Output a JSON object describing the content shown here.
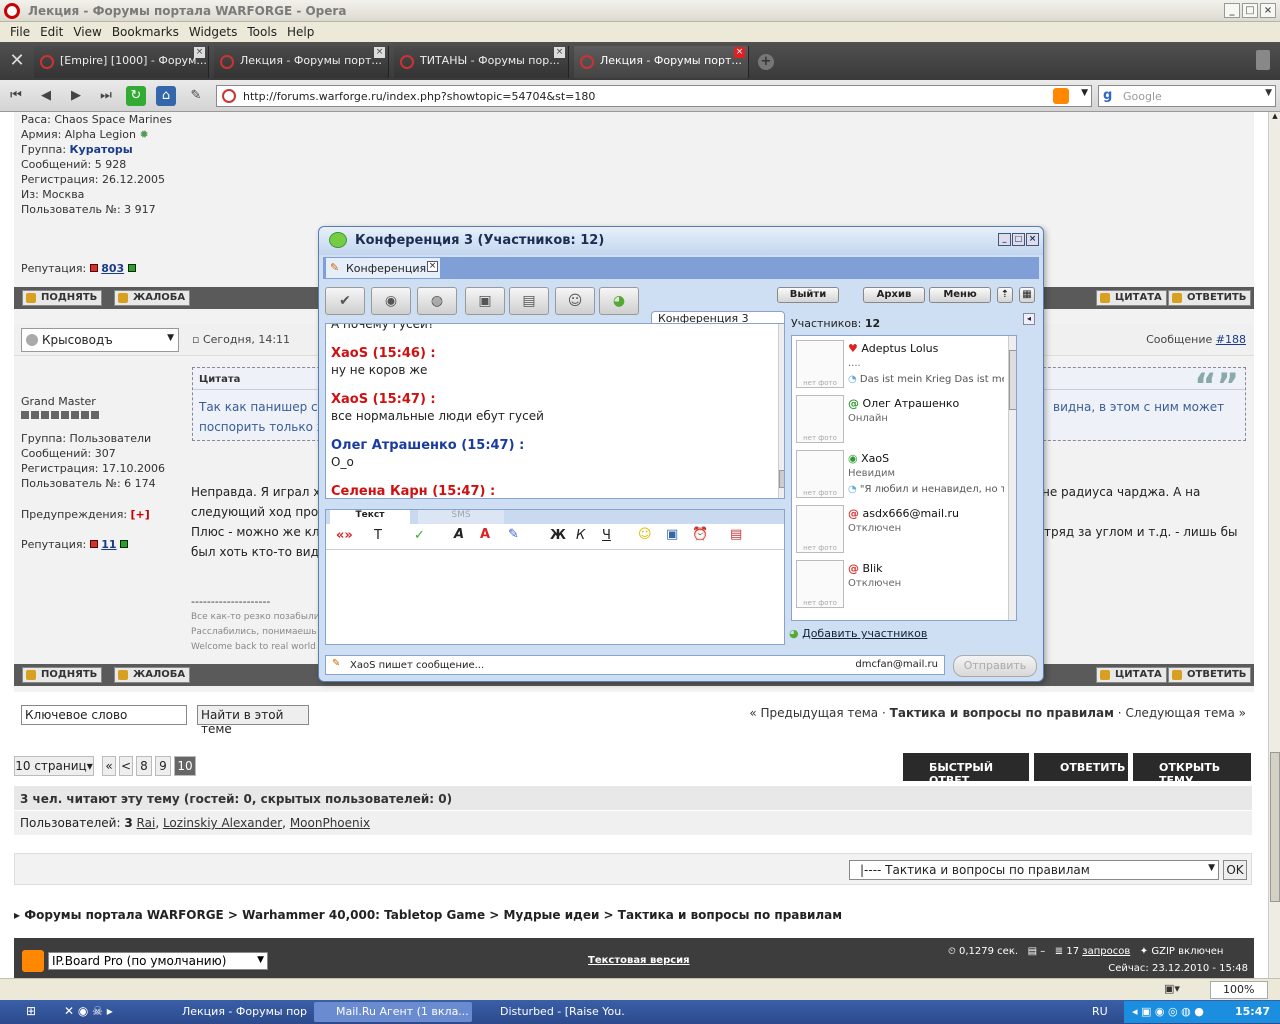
{
  "window": {
    "title": "Лекция - Форумы портала WARFORGE - Opera"
  },
  "menu": [
    "File",
    "Edit",
    "View",
    "Bookmarks",
    "Widgets",
    "Tools",
    "Help"
  ],
  "tabs": [
    {
      "label": "[Empire] [1000] - Форум..."
    },
    {
      "label": "Лекция - Форумы порт..."
    },
    {
      "label": "ТИТАНЫ - Форумы пор..."
    },
    {
      "label": "Лекция - Форумы порт..."
    }
  ],
  "address": {
    "url": "http://forums.warforge.ru/index.php?showtopic=54704&st=180",
    "search_placeholder": "Google"
  },
  "profile1": {
    "race": "Раса: Chaos Space Marines",
    "army": "Армия: Alpha Legion",
    "group_label": "Группа:",
    "group": "Кураторы",
    "messages": "Сообщений: 5 928",
    "registration": "Регистрация: 26.12.2005",
    "from": "Из: Москва",
    "user_no": "Пользователь №: 3 917",
    "reputation_label": "Репутация:",
    "reputation": "803"
  },
  "buttons": {
    "up": "ПОДНЯТЬ",
    "complaint": "ЖАЛОБА",
    "quote": "ЦИТАТА",
    "reply": "ОТВЕТИТЬ"
  },
  "post2": {
    "author": "Крысоводъ",
    "time": "Сегодня, 14:11",
    "msg_label": "Сообщение",
    "msg_no": "#188",
    "rank": "Grand Master",
    "group": "Группа: Пользователи",
    "messages": "Сообщений: 307",
    "registration": "Регистрация: 17.10.2006",
    "user_no": "Пользователь №: 6 174",
    "warnings_label": "Предупреждения:",
    "warnings": "[+]",
    "reputation_label": "Репутация:",
    "reputation": "11",
    "quote_title": "Цитата",
    "quote_line1": "Так как панишер спо",
    "quote_line1_right": "видна, в этом с ним может",
    "quote_line2": "поспорить только хе",
    "text_l1": "Неправда. Я играл хе",
    "text_l1_right": "не радиуса чарджа. А на",
    "text_l2": "следующий ход прое",
    "text_l3": "Плюс - можно же кла",
    "text_l3_right": "тряд за углом и т.д. - лишь бы",
    "text_l4": "был хоть кто-то виден",
    "sig_sep": "--------------------",
    "sig1": "Все как-то резко позабыли",
    "sig2": "Расслабились, понимаешь",
    "sig3": "Welcome back to real world"
  },
  "search": {
    "placeholder": "Ключевое слово",
    "button": "Найти в этой теме"
  },
  "topicnav": {
    "prev": "« Предыдущая тема",
    "sep": "·",
    "current": "Тактика и вопросы по правилам",
    "next": "Следующая тема »"
  },
  "pagination": {
    "pages_label": "10 страниц",
    "first": "«",
    "prev": "<",
    "p8": "8",
    "p9": "9",
    "p10": "10"
  },
  "actions": {
    "fast_reply": "БЫСТРЫЙ ОТВЕТ",
    "reply": "ОТВЕТИТЬ",
    "new_topic": "ОТКРЫТЬ ТЕМУ"
  },
  "readers": {
    "summary": "3 чел. читают эту тему (гостей: 0, скрытых пользователей: 0)",
    "users_label": "Пользователей:",
    "users_count": "3",
    "u1": "Rai",
    "u2": "Lozinskiy Alexander",
    "u3": "MoonPhoenix"
  },
  "jump": {
    "selected": "|---- Тактика и вопросы по правилам",
    "ok": "OK"
  },
  "breadcrumb": [
    "Форумы портала WARFORGE",
    "Warhammer 40,000: Tabletop Game",
    "Мудрые идеи",
    "Тактика и вопросы по правилам"
  ],
  "footer": {
    "skin": "IP.Board Pro (по умолчанию)",
    "text_version": "Текстовая версия",
    "time": "0,1279 сек.",
    "dash": "–",
    "queries_count": "17",
    "queries": "запросов",
    "gzip": "GZIP включен",
    "now": "Сейчас: 23.12.2010 - 15:48"
  },
  "conference": {
    "title": "Конференция 3 (Участников: 12)",
    "tab": "Конференция 3",
    "chat_tab": "Конференция 3",
    "exit": "Выйти",
    "archive": "Архив",
    "menu": "Меню",
    "participants_label": "Участников:",
    "participants_count": "12",
    "messages": [
      {
        "nick": "",
        "time": "",
        "text": "А почему гусей?"
      },
      {
        "nick": "XaoS",
        "time": "(15:46) :",
        "text": "ну не коров же"
      },
      {
        "nick": "XaoS",
        "time": "(15:47) :",
        "text": "все нормальные люди ебут гусей"
      },
      {
        "nick": "Олег Атрашенко",
        "time": "(15:47) :",
        "text": "О_о"
      },
      {
        "nick": "Селена Карн",
        "time": "(15:47) :",
        "text": ""
      }
    ],
    "input_tab_text": "Текст",
    "input_tab_sms": "SMS",
    "people": [
      {
        "name": "Adeptus Lolus",
        "status": "....",
        "note": "Das ist mein Krieg Das ist mei"
      },
      {
        "name": "Олег Атрашенко",
        "status": "Онлайн",
        "note": ""
      },
      {
        "name": "XaoS",
        "status": "Невидим",
        "note": "\"Я любил и ненавидел, но т"
      },
      {
        "name": "asdx666@mail.ru",
        "status": "Отключен",
        "note": ""
      },
      {
        "name": "Blik",
        "status": "Отключен",
        "note": ""
      }
    ],
    "no_photo": "нет фото",
    "add_participants": "Добавить участников",
    "typing": "XaoS пишет сообщение...",
    "account": "dmcfan@mail.ru",
    "send": "Отправить"
  },
  "taskbar": {
    "items": [
      "Лекция - Форумы пор...",
      "Mail.Ru Агент (1 вкла...",
      "Disturbed - [Raise You..."
    ],
    "lang": "RU",
    "clock": "15:47"
  },
  "zoom": "100%"
}
